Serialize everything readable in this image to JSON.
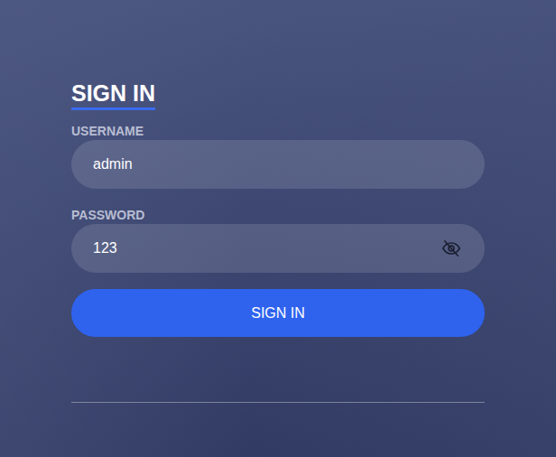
{
  "title": "SIGN IN",
  "fields": [
    {
      "label": "USERNAME",
      "value": "admin",
      "kind": "text"
    },
    {
      "label": "PASSWORD",
      "value": "123",
      "kind": "password",
      "revealed": true
    }
  ],
  "button": "SIGN IN"
}
